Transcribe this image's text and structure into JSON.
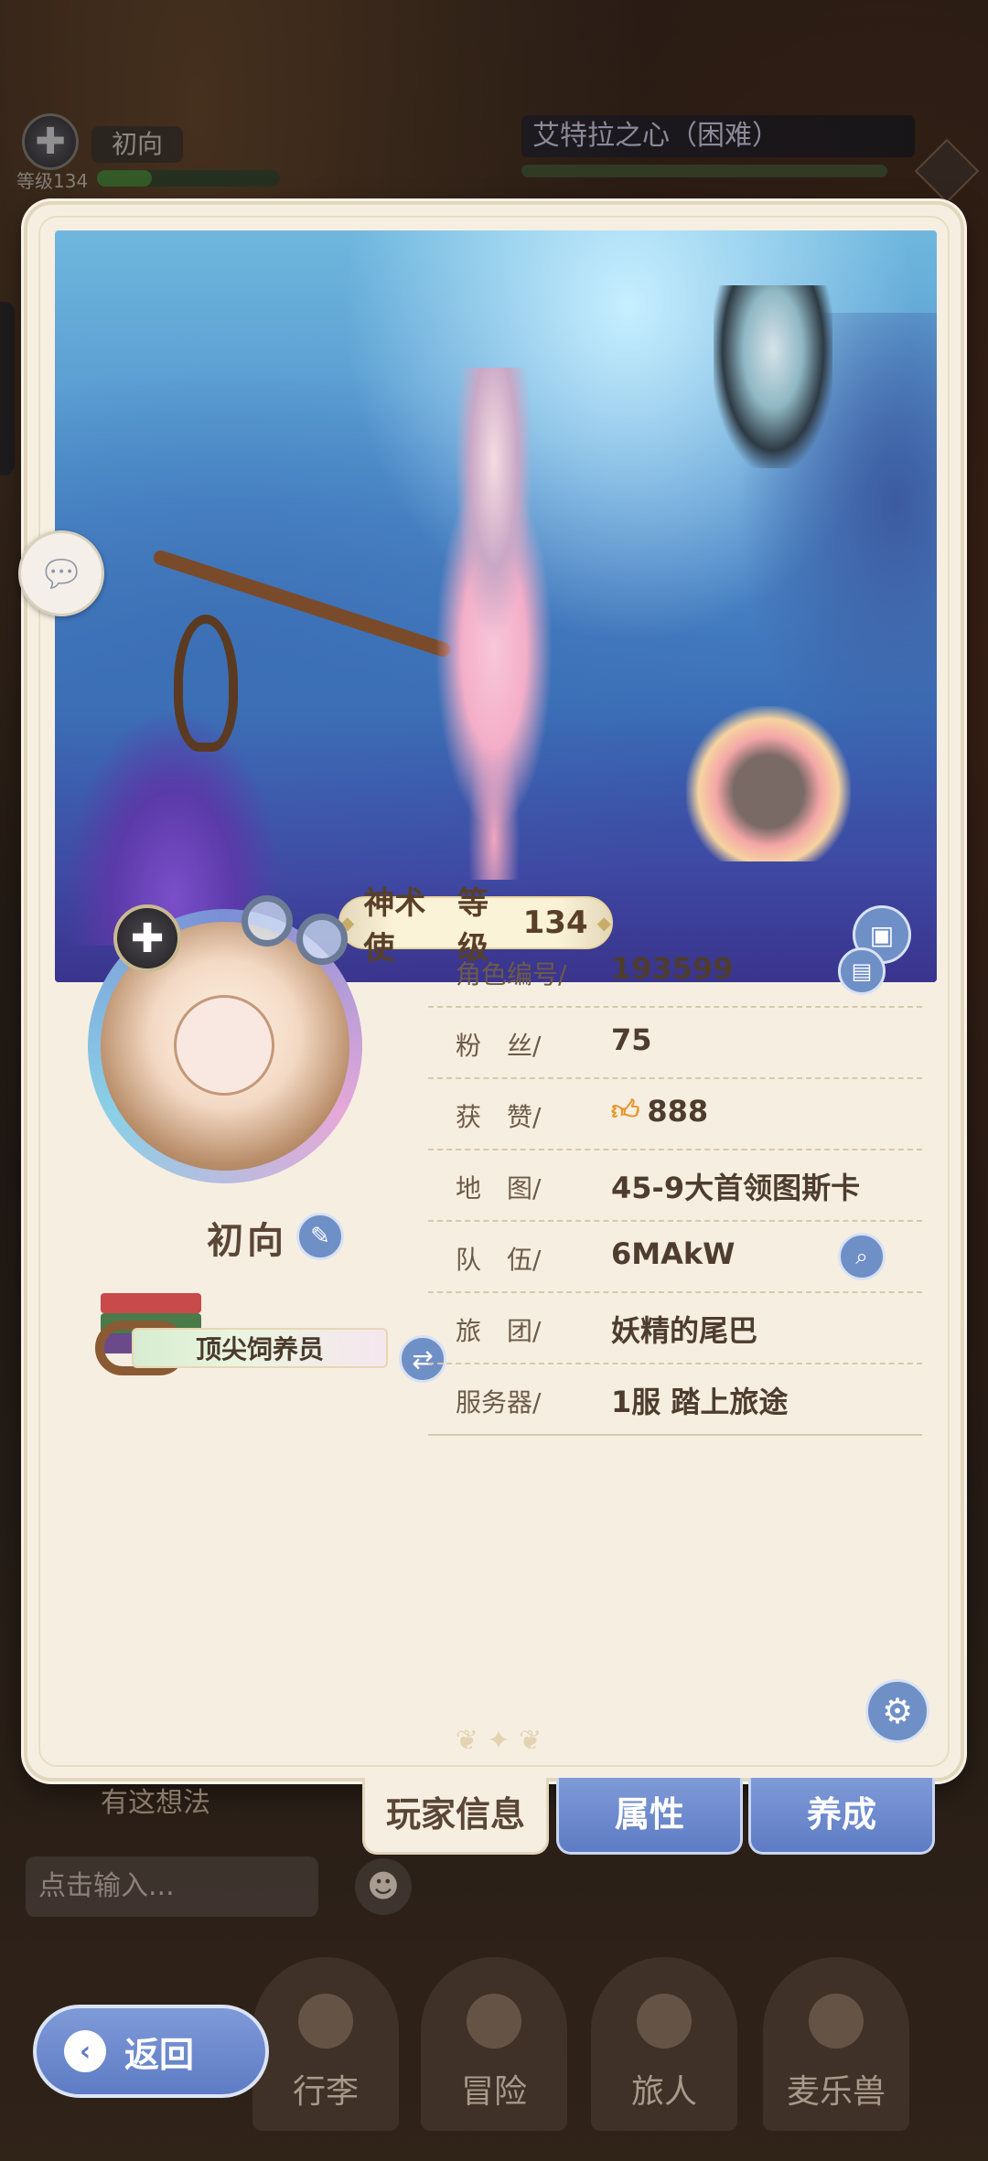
{
  "hud": {
    "player_name": "初向",
    "level_label": "等级134",
    "stage_title": "艾特拉之心（困难）"
  },
  "card": {
    "class_name": "神术使",
    "level_word": "等级",
    "level_value": "134",
    "player_name": "初向",
    "title_badge": "顶尖饲养员",
    "info": [
      {
        "label": "角色编号/",
        "value": "193599"
      },
      {
        "label": "粉　丝/",
        "value": "75"
      },
      {
        "label": "获　赞/",
        "value": "888"
      },
      {
        "label": "地　图/",
        "value": "45-9大首领图斯卡"
      },
      {
        "label": "队　伍/",
        "value": "6MAkW"
      },
      {
        "label": "旅　团/",
        "value": "妖精的尾巴"
      },
      {
        "label": "服务器/",
        "value": "1服  踏上旅途"
      }
    ]
  },
  "tabs": [
    "玩家信息",
    "属性",
    "养成"
  ],
  "chat": {
    "snippet": "有这想法",
    "input_placeholder": "点击输入..."
  },
  "nav": {
    "items": [
      "行李",
      "冒险",
      "旅人",
      "麦乐兽"
    ],
    "back_label": "返回"
  },
  "icons": {
    "class_icon": "cross-emblem-icon",
    "chat_icon": "chat-bubbles-icon",
    "gallery_icon": "portrait-card-icon",
    "copy_icon": "copy-document-icon",
    "like_icon": "thumbs-up-icon",
    "search_icon": "magnifier-icon",
    "edit_icon": "pencil-icon",
    "swap_icon": "swap-arrows-icon",
    "settings_icon": "gear-icon",
    "back_icon": "chevron-left-icon"
  },
  "colors": {
    "accent_blue": "#6f8fc7",
    "card_bg": "#f6efe1",
    "text_brown": "#5a4636",
    "like_orange": "#e8952e"
  }
}
